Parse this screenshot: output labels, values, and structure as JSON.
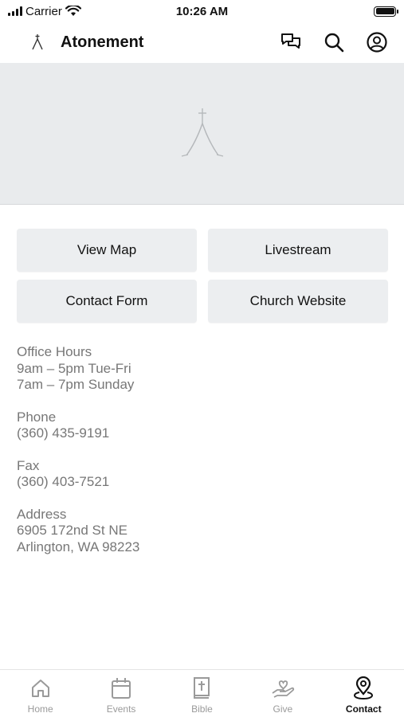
{
  "status_bar": {
    "carrier": "Carrier",
    "time": "10:26 AM"
  },
  "header": {
    "title": "Atonement",
    "icons": [
      "logo-icon",
      "chat-icon",
      "search-icon",
      "profile-icon"
    ]
  },
  "hero": {
    "icon": "church-logo-icon"
  },
  "buttons": [
    {
      "label": "View Map"
    },
    {
      "label": "Livestream"
    },
    {
      "label": "Contact Form"
    },
    {
      "label": "Church Website"
    }
  ],
  "info": {
    "office_hours": {
      "label": "Office Hours",
      "lines": [
        "9am – 5pm Tue-Fri",
        "7am – 7pm Sunday"
      ]
    },
    "phone": {
      "label": "Phone",
      "value": "(360) 435-9191"
    },
    "fax": {
      "label": "Fax",
      "value": "(360) 403-7521"
    },
    "address": {
      "label": "Address",
      "lines": [
        "6905 172nd St NE",
        "Arlington, WA 98223"
      ]
    }
  },
  "tabs": [
    {
      "label": "Home",
      "icon": "home-icon",
      "active": false
    },
    {
      "label": "Events",
      "icon": "calendar-icon",
      "active": false
    },
    {
      "label": "Bible",
      "icon": "bible-icon",
      "active": false
    },
    {
      "label": "Give",
      "icon": "give-icon",
      "active": false
    },
    {
      "label": "Contact",
      "icon": "location-pin-icon",
      "active": true
    }
  ],
  "colors": {
    "hero_bg": "#e9ebed",
    "button_bg": "#eceef0",
    "info_text": "#777777",
    "tab_inactive": "#9a9a9a",
    "tab_active": "#111111"
  }
}
